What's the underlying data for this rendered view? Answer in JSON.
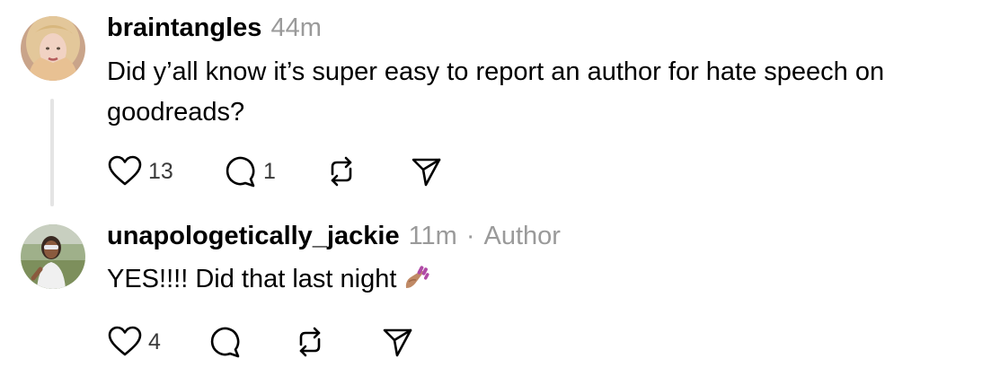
{
  "posts": [
    {
      "username": "braintangles",
      "time": "44m",
      "text": "Did y’all know it’s super easy to report an author for hate speech on goodreads?",
      "likes": "13",
      "replies": "1",
      "avatar_icon": "user-avatar-blonde"
    },
    {
      "username": "unapologetically_jackie",
      "time": "11m",
      "separator": "·",
      "badge": "Author",
      "text": "YES!!!! Did that last night",
      "emoji": "nail-polish-emoji",
      "likes": "4",
      "avatar_icon": "user-avatar-outdoor"
    }
  ],
  "icons": {
    "like": "heart-icon",
    "reply": "comment-icon",
    "repost": "repost-icon",
    "share": "send-icon"
  },
  "colors": {
    "text": "#000000",
    "muted": "#9a9a9a",
    "thread_line": "#e4e4e4"
  }
}
